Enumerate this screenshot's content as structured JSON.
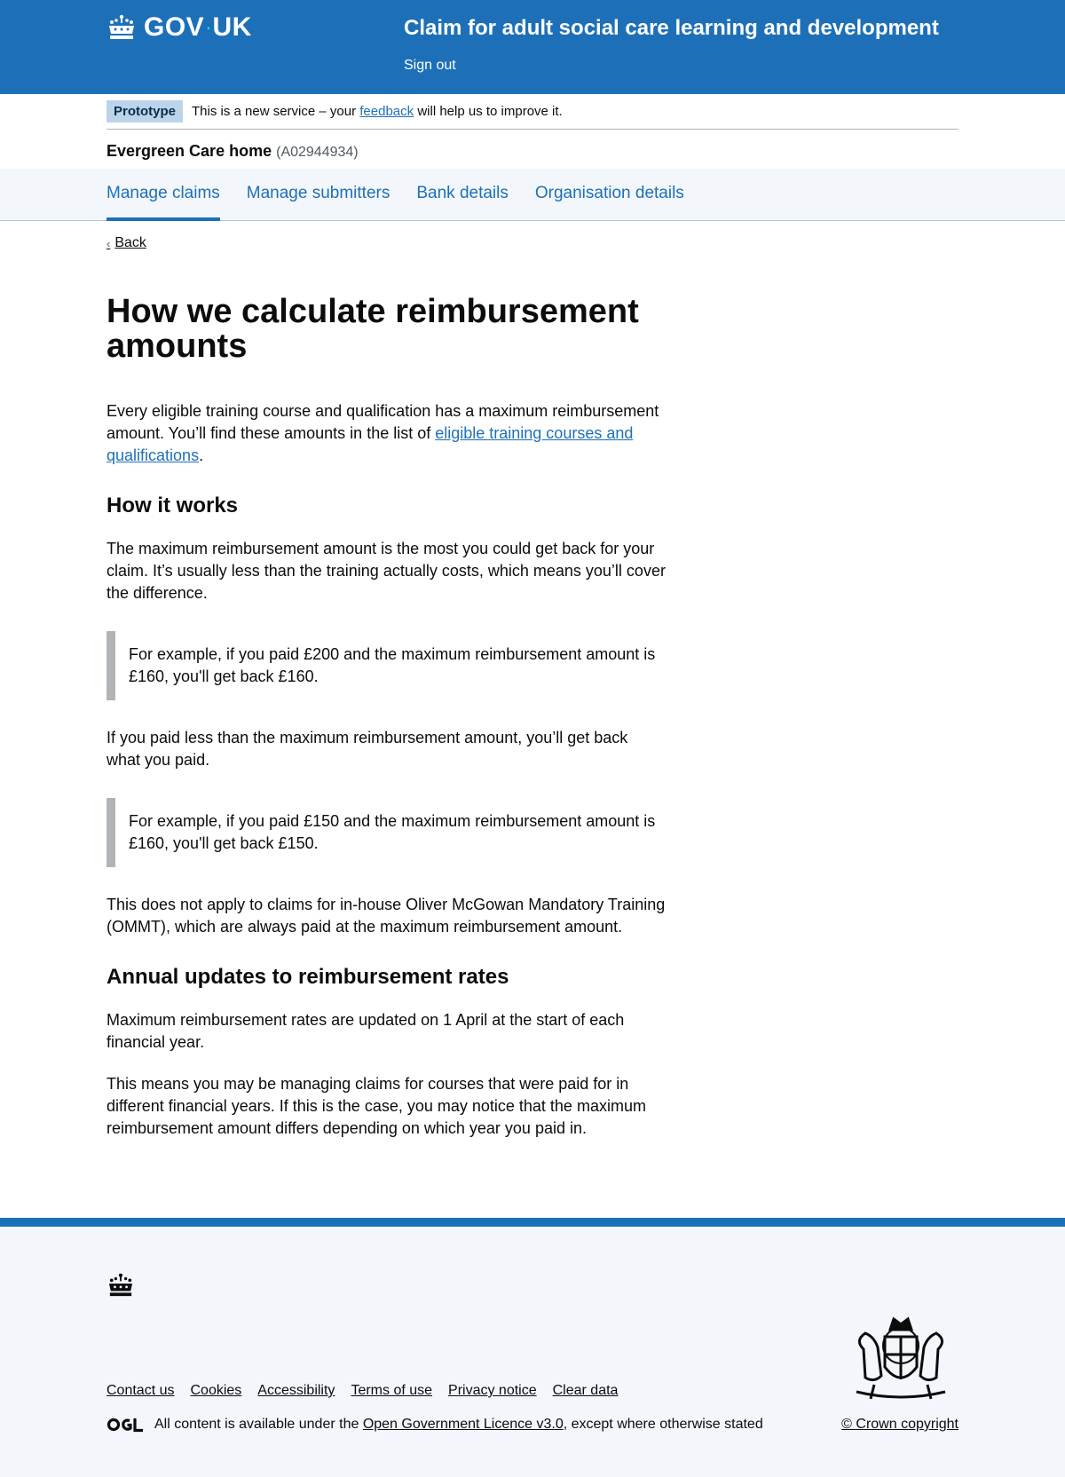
{
  "header": {
    "logo_text_gov": "GOV",
    "logo_dot": "·",
    "logo_text_uk": "UK",
    "service_name": "Claim for adult social care learning and development",
    "sign_out": "Sign out"
  },
  "phase_banner": {
    "tag": "Prototype",
    "text_before": "This is a new service – your ",
    "link": "feedback",
    "text_after": " will help us to improve it."
  },
  "organisation": {
    "name": "Evergreen Care home",
    "id": "(A02944934)"
  },
  "subnav": {
    "items": [
      {
        "label": "Manage claims",
        "active": true
      },
      {
        "label": "Manage submitters",
        "active": false
      },
      {
        "label": "Bank details",
        "active": false
      },
      {
        "label": "Organisation details",
        "active": false
      }
    ]
  },
  "back_link": "Back",
  "main": {
    "title": "How we calculate reimbursement amounts",
    "intro_before": "Every eligible training course and qualification has a maximum reimbursement amount. You’ll find these amounts in the list of ",
    "intro_link": "eligible training courses and qualifications",
    "intro_after": ".",
    "h_how": "How it works",
    "p_how": "The maximum reimbursement amount is the most you could get back for your claim. It’s usually less than the training actually costs, which means you’ll cover the difference.",
    "inset1": "For example, if you paid £200 and the maximum reimbursement amount is £160, you'll get back £160.",
    "p_less": "If you paid less than the maximum reimbursement amount, you’ll get back what you paid.",
    "inset2": "For example, if you paid £150 and the maximum reimbursement amount is £160, you'll get back £150.",
    "p_ommt": "This does not apply to claims for in-house Oliver McGowan Mandatory Training (OMMT), which are always paid at the maximum reimbursement amount.",
    "h_annual": "Annual updates to reimbursement rates",
    "p_annual1": "Maximum reimbursement rates are updated on 1 April at the start of each financial year.",
    "p_annual2": "This means you may be managing claims for courses that were paid for in different financial years. If this is the case, you may notice that the maximum reimbursement amount differs depending on which year you paid in."
  },
  "footer": {
    "links": [
      "Contact us",
      "Cookies",
      "Accessibility",
      "Terms of use",
      "Privacy notice",
      "Clear data"
    ],
    "licence_before": "All content is available under the ",
    "licence_link": "Open Government Licence v3.0",
    "licence_after": ", except where otherwise stated",
    "copyright": "© Crown copyright"
  },
  "colors": {
    "brand_blue": "#1d70b8",
    "footer_bg": "#f3f7fb",
    "inset_border": "#b1b4b6"
  }
}
